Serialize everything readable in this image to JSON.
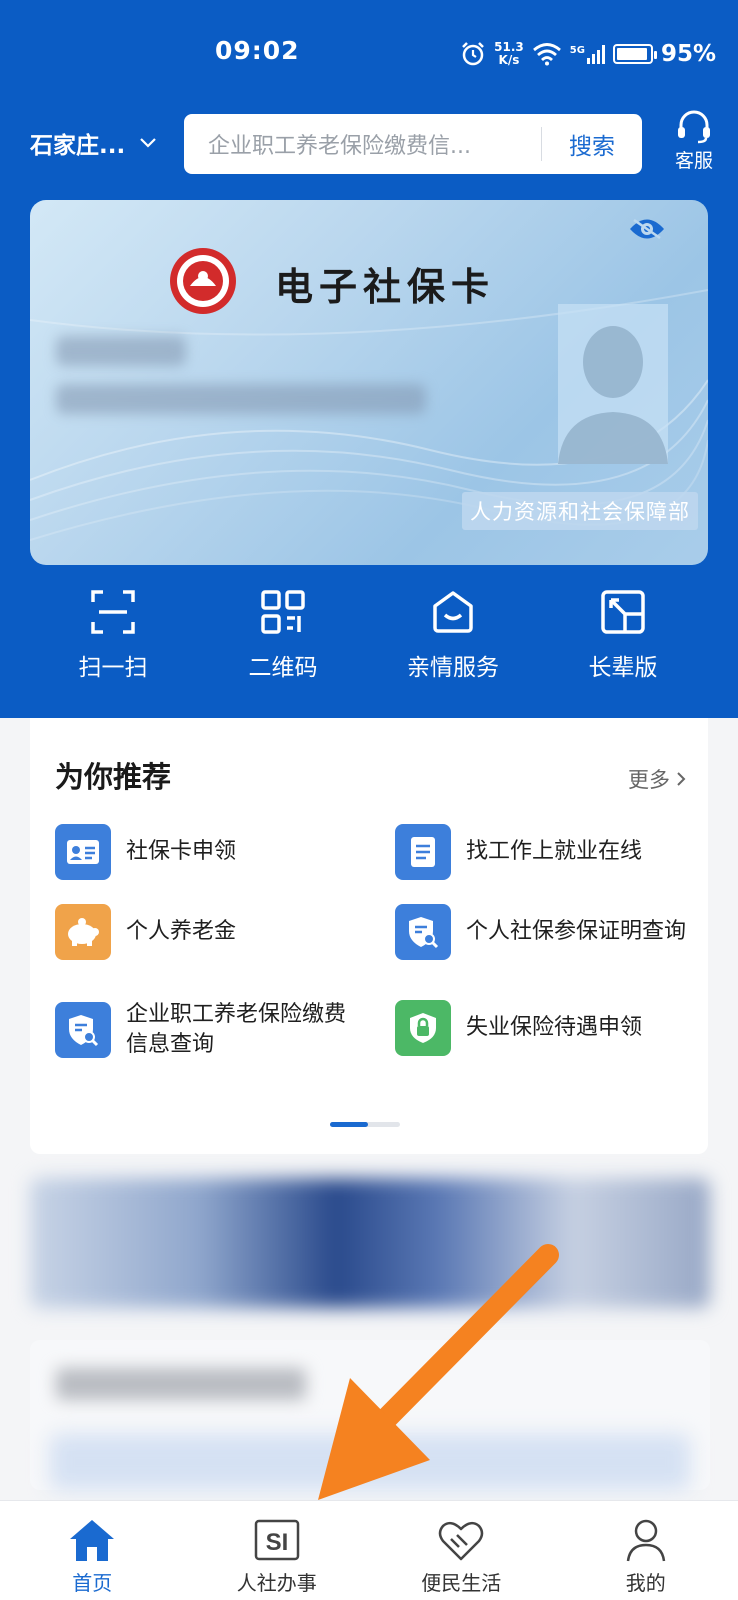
{
  "status_bar": {
    "time": "09:02",
    "net_speed_value": "51.3",
    "net_speed_unit": "K/s",
    "network": "5G",
    "battery": "95%"
  },
  "header": {
    "city": "石家庄...",
    "search_placeholder": "企业职工养老保险缴费信...",
    "search_button": "搜索",
    "service_label": "客服"
  },
  "card": {
    "title": "电子社保卡",
    "issuer": "人力资源和社会保障部"
  },
  "quick_actions": [
    {
      "label": "扫一扫",
      "icon": "scan-icon"
    },
    {
      "label": "二维码",
      "icon": "qrcode-icon"
    },
    {
      "label": "亲情服务",
      "icon": "family-service-icon"
    },
    {
      "label": "长辈版",
      "icon": "elder-mode-icon"
    }
  ],
  "recommend": {
    "title": "为你推荐",
    "more": "更多",
    "items": [
      {
        "label": "社保卡申领",
        "icon": "id-card-icon",
        "color": "#3d7fdb"
      },
      {
        "label": "找工作上就业在线",
        "icon": "document-icon",
        "color": "#3d7fdb"
      },
      {
        "label": "个人养老金",
        "icon": "piggy-bank-icon",
        "color": "#f0a34a"
      },
      {
        "label": "个人社保参保证明查询",
        "icon": "shield-search-icon",
        "color": "#3d7fdb"
      },
      {
        "label": "企业职工养老保险缴费信息查询",
        "icon": "shield-search-icon",
        "color": "#3d7fdb"
      },
      {
        "label": "失业保险待遇申领",
        "icon": "lock-shield-icon",
        "color": "#4cb866"
      }
    ]
  },
  "tabbar": [
    {
      "label": "首页",
      "icon": "home-icon",
      "active": true
    },
    {
      "label": "人社办事",
      "icon": "si-icon",
      "active": false
    },
    {
      "label": "便民生活",
      "icon": "heart-hands-icon",
      "active": false
    },
    {
      "label": "我的",
      "icon": "user-icon",
      "active": false
    }
  ],
  "colors": {
    "header_blue": "#0b5cc4",
    "accent": "#1a6ad0",
    "arrow": "#f58220"
  }
}
